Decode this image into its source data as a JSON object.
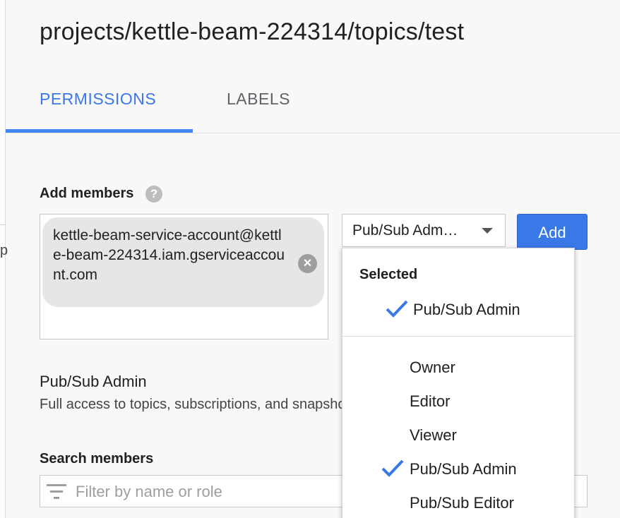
{
  "page": {
    "title": "projects/kettle-beam-224314/topics/test",
    "left_fragment": "p"
  },
  "tabs": [
    {
      "label": "PERMISSIONS",
      "active": true
    },
    {
      "label": "LABELS",
      "active": false
    }
  ],
  "add_members": {
    "label": "Add members",
    "help_glyph": "?",
    "chip_text": "kettle-beam-service-account@kettle-beam-224314.iam.gserviceaccount.com",
    "chip_remove_glyph": "×",
    "role_select_value": "Pub/Sub Adm…",
    "add_button_label": "Add"
  },
  "role_info": {
    "title": "Pub/Sub Admin",
    "description": "Full access to topics, subscriptions, and snapshots."
  },
  "search": {
    "label": "Search members",
    "placeholder": "Filter by name or role"
  },
  "dropdown": {
    "heading": "Selected",
    "selected_items": [
      {
        "label": "Pub/Sub Admin",
        "checked": true
      }
    ],
    "items": [
      {
        "label": "Owner",
        "checked": false
      },
      {
        "label": "Editor",
        "checked": false
      },
      {
        "label": "Viewer",
        "checked": false
      },
      {
        "label": "Pub/Sub Admin",
        "checked": true
      },
      {
        "label": "Pub/Sub Editor",
        "checked": false
      }
    ]
  },
  "colors": {
    "accent": "#3b78e7",
    "tab_underline": "#4285f4",
    "chip_background": "#e6e6e6",
    "page_background": "#f8f8f8"
  },
  "icons": {
    "help": "help-icon",
    "chip_remove": "close-circle-icon",
    "select_caret": "chevron-down-icon",
    "filter": "filter-icon",
    "check": "check-icon"
  }
}
